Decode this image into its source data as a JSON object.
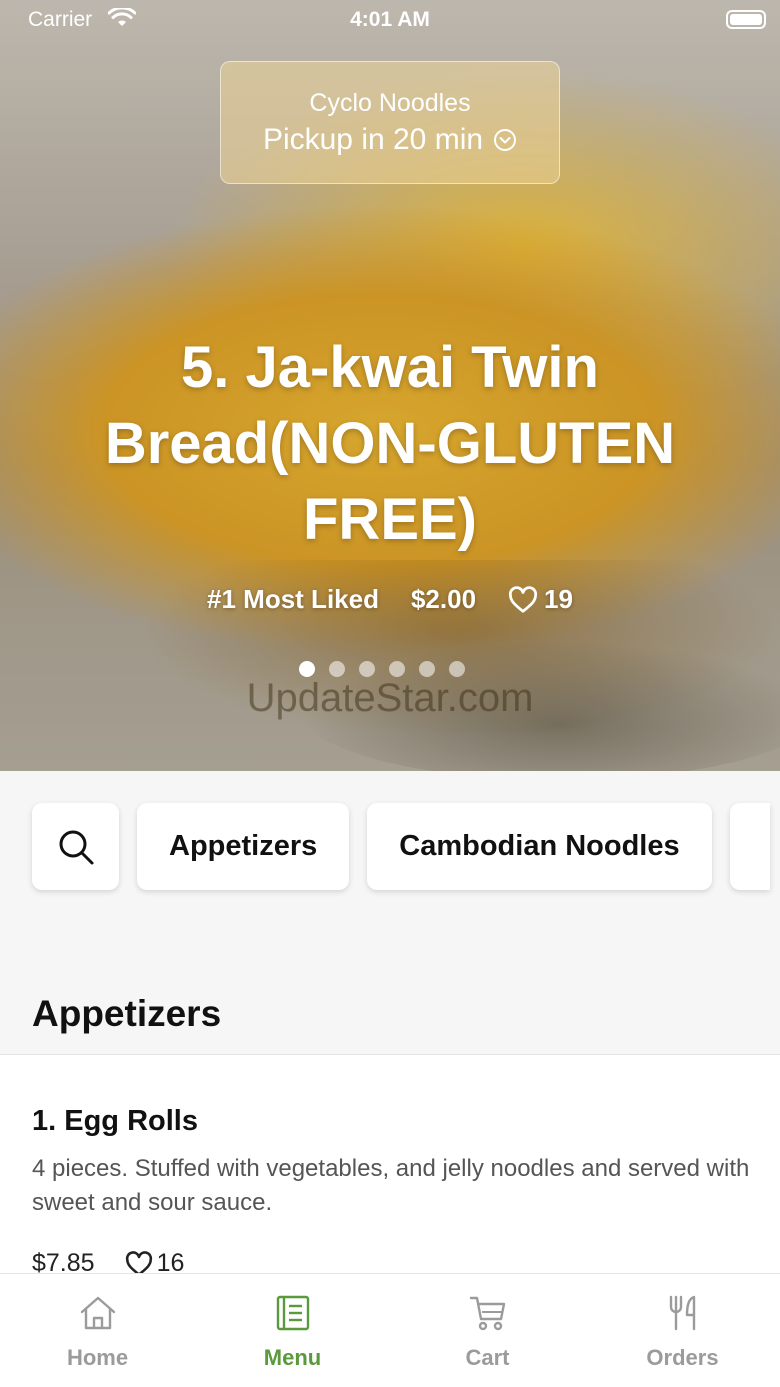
{
  "status_bar": {
    "carrier": "Carrier",
    "time": "4:01 AM"
  },
  "pickup": {
    "restaurant": "Cyclo Noodles",
    "label": "Pickup in 20 min"
  },
  "hero": {
    "title": "5. Ja-kwai Twin Bread(NON-GLUTEN FREE)",
    "rank": "#1 Most Liked",
    "price": "$2.00",
    "likes": "19",
    "slide_count": 6,
    "active_slide": 1,
    "watermark": "UpdateStar.com"
  },
  "categories": {
    "items": [
      {
        "label": "Appetizers"
      },
      {
        "label": "Cambodian Noodles"
      }
    ]
  },
  "section": {
    "title": "Appetizers"
  },
  "items": [
    {
      "name": "1. Egg Rolls",
      "description": "4 pieces. Stuffed with vegetables, and jelly noodles and served with sweet and sour sauce.",
      "price": "$7.85",
      "likes": "16"
    }
  ],
  "tabbar": {
    "tabs": [
      {
        "label": "Home",
        "icon": "home-icon"
      },
      {
        "label": "Menu",
        "icon": "menu-icon"
      },
      {
        "label": "Cart",
        "icon": "cart-icon"
      },
      {
        "label": "Orders",
        "icon": "utensils-icon"
      }
    ],
    "active": "Menu"
  },
  "colors": {
    "accent": "#5b9a3c",
    "inactive": "#9b9b9b"
  }
}
